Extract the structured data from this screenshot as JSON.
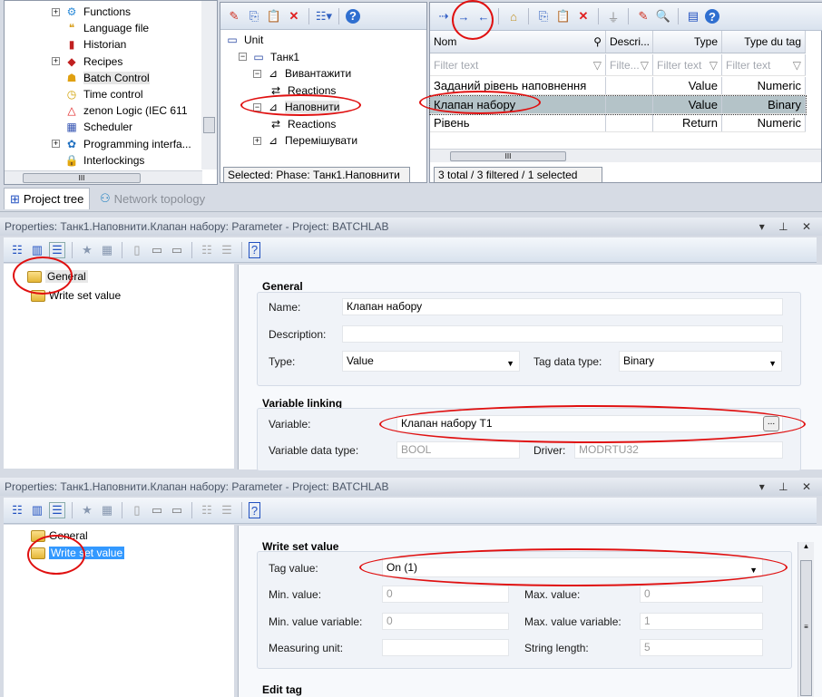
{
  "project_tree": {
    "items": [
      {
        "label": "Functions",
        "expandable": true,
        "icon": "functions-icon"
      },
      {
        "label": "Language file",
        "expandable": false,
        "icon": "language-file-icon"
      },
      {
        "label": "Historian",
        "expandable": false,
        "icon": "historian-icon"
      },
      {
        "label": "Recipes",
        "expandable": true,
        "icon": "recipes-icon"
      },
      {
        "label": "Batch Control",
        "expandable": false,
        "icon": "batch-control-icon",
        "selected": true
      },
      {
        "label": "Time control",
        "expandable": false,
        "icon": "clock-icon"
      },
      {
        "label": "zenon Logic (IEC 611",
        "expandable": false,
        "icon": "zenon-logic-icon"
      },
      {
        "label": "Scheduler",
        "expandable": false,
        "icon": "calendar-icon"
      },
      {
        "label": "Programming interfa...",
        "expandable": true,
        "icon": "programming-interface-icon"
      },
      {
        "label": "Interlockings",
        "expandable": false,
        "icon": "lock-icon"
      }
    ]
  },
  "unit_tree": {
    "items": [
      {
        "label": "Unit",
        "level": 0,
        "exp": ""
      },
      {
        "label": "Танк1",
        "level": 1,
        "exp": "−"
      },
      {
        "label": "Вивантажити",
        "level": 2,
        "exp": "−"
      },
      {
        "label": "Reactions",
        "level": 3,
        "exp": ""
      },
      {
        "label": "Наповнити",
        "level": 2,
        "exp": "−",
        "selected": true
      },
      {
        "label": "Reactions",
        "level": 3,
        "exp": ""
      },
      {
        "label": "Перемішувати",
        "level": 2,
        "exp": "+"
      }
    ],
    "status": "Selected: Phase: Танк1.Наповнити"
  },
  "parameter_grid": {
    "columns": [
      "Nom",
      "Descri...",
      "Type",
      "Type du tag"
    ],
    "filters": [
      "Filter text",
      "Filte...",
      "Filter text",
      "Filter text"
    ],
    "rows": [
      [
        "Заданий рівень наповнення",
        "",
        "Value",
        "Numeric"
      ],
      [
        "Клапан набору",
        "",
        "Value",
        "Binary"
      ],
      [
        "Рівень",
        "",
        "Return",
        "Numeric"
      ]
    ],
    "selected_row": 1,
    "status": "3 total / 3 filtered / 1 selected"
  },
  "tabs": [
    {
      "label": "Project tree",
      "active": true
    },
    {
      "label": "Network topology",
      "active": false
    }
  ],
  "properties1": {
    "title": "Properties: Танк1.Наповнити.Клапан набору: Parameter - Project: BATCHLAB",
    "tree": [
      "General",
      "Write set value"
    ],
    "general": {
      "heading": "General",
      "name_label": "Name:",
      "name": "Клапан набору",
      "description_label": "Description:",
      "description": "",
      "type_label": "Type:",
      "type": "Value",
      "tag_type_label": "Tag data type:",
      "tag_type": "Binary"
    },
    "linking": {
      "heading": "Variable linking",
      "variable_label": "Variable:",
      "variable": "Клапан набору T1",
      "browse": "...",
      "vdt_label": "Variable data type:",
      "vdt": "BOOL",
      "driver_label": "Driver:",
      "driver": "MODRTU32"
    }
  },
  "properties2": {
    "title": "Properties: Танк1.Наповнити.Клапан набору: Parameter - Project: BATCHLAB",
    "tree": [
      "General",
      "Write set value"
    ],
    "wsv": {
      "heading": "Write set value",
      "tag_value_label": "Tag value:",
      "tag_value": "On (1)",
      "min_label": "Min. value:",
      "min": "0",
      "max_label": "Max. value:",
      "max": "0",
      "minvar_label": "Min. value variable:",
      "minvar": "0",
      "maxvar_label": "Max. value variable:",
      "maxvar": "1",
      "unit_label": "Measuring unit:",
      "unit": "",
      "strlen_label": "String length:",
      "strlen": "5"
    },
    "edit_tag": "Edit tag"
  },
  "colors": {
    "annotation": "#e01010",
    "selection": "#3399ff",
    "selected_row": "#b4c3c8"
  }
}
